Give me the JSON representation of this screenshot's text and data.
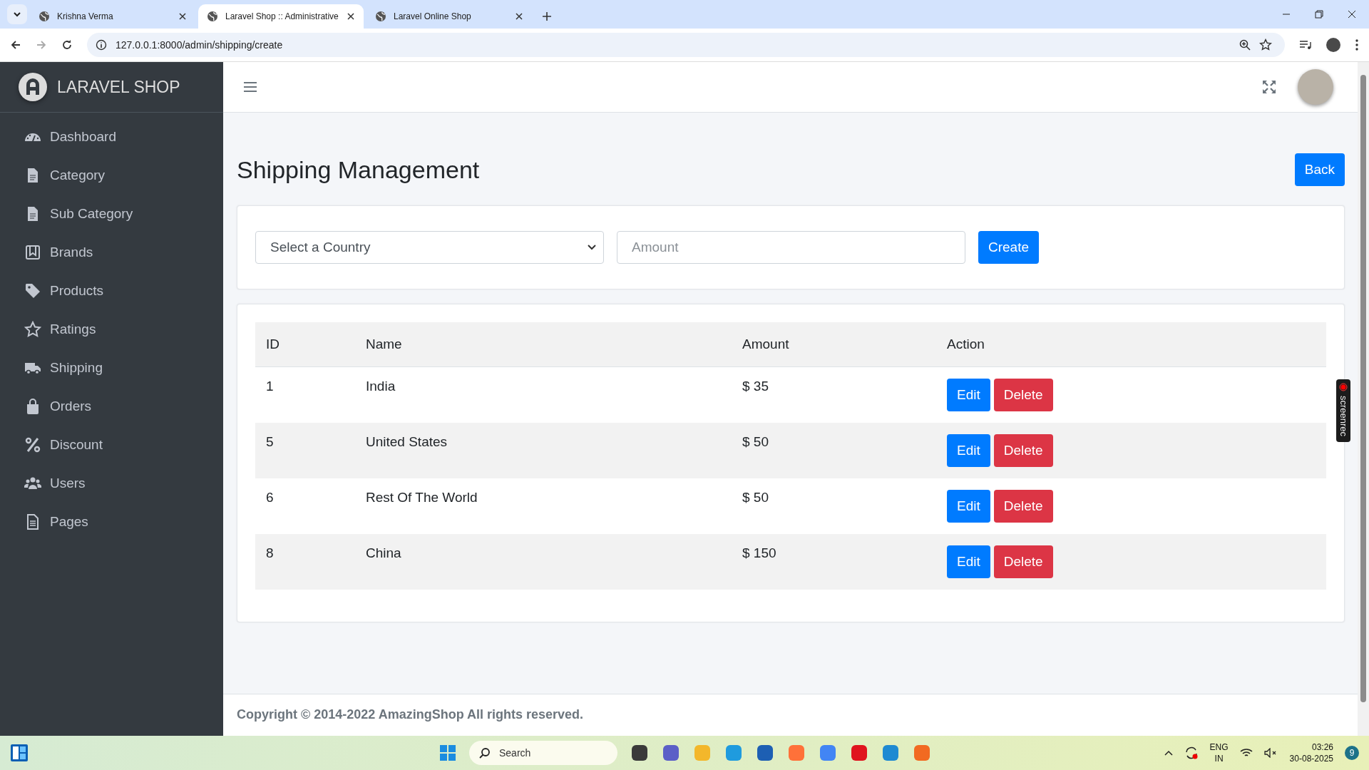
{
  "browser": {
    "tabs": [
      {
        "title": "Krishna Verma",
        "selected": false
      },
      {
        "title": "Laravel Shop :: Administrative",
        "selected": true
      },
      {
        "title": "Laravel Online Shop",
        "selected": false
      }
    ],
    "url": "127.0.0.1:8000/admin/shipping/create"
  },
  "sidebar": {
    "brand": "LARAVEL SHOP",
    "items": [
      {
        "label": "Dashboard"
      },
      {
        "label": "Category"
      },
      {
        "label": "Sub Category"
      },
      {
        "label": "Brands"
      },
      {
        "label": "Products"
      },
      {
        "label": "Ratings"
      },
      {
        "label": "Shipping"
      },
      {
        "label": "Orders"
      },
      {
        "label": "Discount"
      },
      {
        "label": "Users"
      },
      {
        "label": "Pages"
      }
    ]
  },
  "page": {
    "title": "Shipping Management",
    "back_button": "Back"
  },
  "form": {
    "country_select": "Select a Country",
    "amount_placeholder": "Amount",
    "create_button": "Create"
  },
  "table": {
    "columns": [
      "ID",
      "Name",
      "Amount",
      "Action"
    ],
    "rows": [
      {
        "id": "1",
        "name": "India",
        "amount": "$ 35",
        "edit": "Edit",
        "delete": "Delete"
      },
      {
        "id": "5",
        "name": "United States",
        "amount": "$ 50",
        "edit": "Edit",
        "delete": "Delete"
      },
      {
        "id": "6",
        "name": "Rest Of The World",
        "amount": "$ 50",
        "edit": "Edit",
        "delete": "Delete"
      },
      {
        "id": "8",
        "name": "China",
        "amount": "$ 150",
        "edit": "Edit",
        "delete": "Delete"
      }
    ]
  },
  "footer": "Copyright © 2014-2022 AmazingShop All rights reserved.",
  "screenrec": "screenrec",
  "taskbar": {
    "search": "Search",
    "language": "ENG",
    "region": "IN",
    "time": "03:26",
    "date": "30-08-2025",
    "notifications": "9"
  }
}
